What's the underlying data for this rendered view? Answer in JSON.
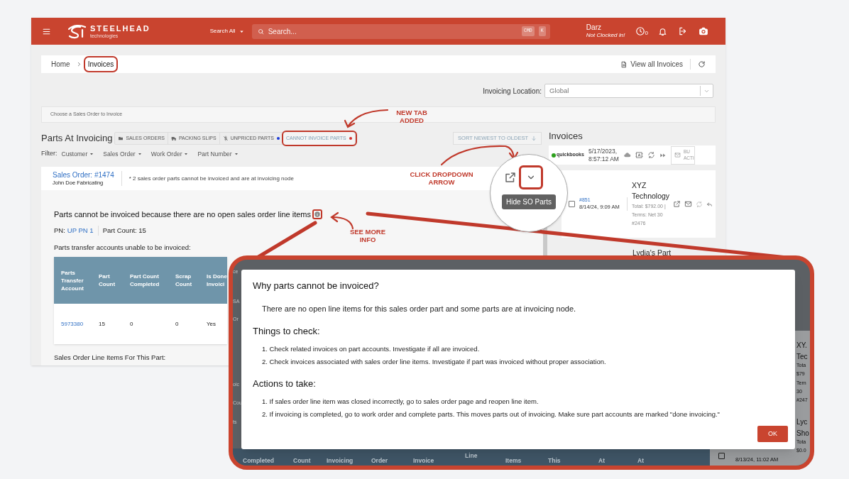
{
  "header": {
    "logo": {
      "wordmark": "STEELHEAD",
      "tagline": "technologies"
    },
    "search_scope": "Search All",
    "search": {
      "placeholder": "Search...",
      "shortcut": [
        "CMD",
        "K"
      ]
    },
    "user": {
      "name": "Darz",
      "status": "Not Clocked In!"
    },
    "clock_count": "0"
  },
  "breadcrumb": [
    {
      "label": "Home",
      "selected": false,
      "highlighted": false
    },
    {
      "label": "Invoices",
      "selected": true,
      "highlighted": true
    }
  ],
  "view_all": "View all Invoices",
  "location": {
    "label": "Invoicing Location:",
    "value": "Global"
  },
  "choose_hint": "Choose a Sales Order to Invoice",
  "parts_title": "Parts At Invoicing",
  "tabs": [
    {
      "label": "SALES ORDERS",
      "selected": false,
      "highlighted": false
    },
    {
      "label": "PACKING SLIPS",
      "selected": false,
      "highlighted": false
    },
    {
      "label": "UNPRICED PARTS",
      "selected": false,
      "highlighted": false,
      "color": "#1a3ad8"
    },
    {
      "label": "CANNOT INVOICE PARTS",
      "selected": true,
      "highlighted": true,
      "color": "#d32f2f"
    }
  ],
  "sort_button": "SORT NEWEST TO OLDEST",
  "filter_label": "Filter:",
  "filters": [
    "Customer",
    "Sales Order",
    "Work Order",
    "Part Number"
  ],
  "sales_order": {
    "link": "Sales Order: #1474",
    "customer": "John Doe Fabricating",
    "note": "* 2 sales order parts cannot be invoiced and are at invoicing node"
  },
  "tooltip": "Hide SO Parts",
  "reason": "Parts cannot be invoiced because there are no open sales order line items",
  "pn_label": "PN:",
  "pn": "UP PN 1",
  "part_count": "Part Count: 15",
  "accounts_title": "Parts transfer accounts unable to be invoiced:",
  "accounts_table": {
    "columns": [
      "Parts Transfer Account",
      "Part Count",
      "Part Count Completed",
      "Scrap Count",
      "Is Done Invoici"
    ],
    "rows": [
      [
        "5973380",
        "15",
        "0",
        "0",
        "Yes"
      ]
    ]
  },
  "line_items_title": "Sales Order Line Items For This Part:",
  "invoices_panel": {
    "title": "Invoices",
    "provider": "quickbooks",
    "sync_time": [
      "5/17/2023,",
      "8:57:12 AM"
    ],
    "bulk_button": [
      "BU",
      "ACTI"
    ],
    "invoices": [
      {
        "number": "#851",
        "date": "8/14/24, 9:09 AM",
        "customer": "XYZ Technology",
        "summary": "Total: $792.00 | Terms: Net 30",
        "ref": "#2476",
        "checked": false
      }
    ],
    "next_customer": "Lydia's Part"
  },
  "annotations": [
    "NEW TAB ADDED",
    "CLICK DROPDOWN ARROW",
    "SEE MORE INFO"
  ],
  "inset": {
    "left_fragments": [
      "ce",
      "SA",
      "Or",
      "oic",
      "Cou",
      "ts"
    ],
    "bottom_headers": [
      "Completed",
      "Count",
      "Invoicing",
      "Order",
      "Invoice",
      "Line",
      "Items",
      "This",
      "At",
      "At"
    ],
    "right_fragments": [
      "XY.",
      "Tec",
      "Tota",
      "$79",
      "Tern",
      "30",
      "#247",
      "Lyc",
      "Sho",
      "Tota",
      "$0.0"
    ],
    "bottom_row": {
      "date": "8/13/24, 11:02 AM",
      "checked": false
    }
  },
  "dialog": {
    "title": "Why parts cannot be invoiced?",
    "message": "There are no open line items for this sales order part and some parts are at invoicing node.",
    "sections": [
      {
        "heading": "Things to check:",
        "items": [
          "1. Check related invoices on part accounts. Investigate if all are invoiced.",
          "2. Check invoices associated with sales order line items. Investigate if part was invoiced without proper association."
        ]
      },
      {
        "heading": "Actions to take:",
        "items": [
          "1. If sales order line item was closed incorrectly, go to sales order page and reopen line item.",
          "2. If invoicing is completed, go to work order and complete parts. This moves parts out of invoicing. Make sure part accounts are marked \"done invoicing.\""
        ]
      }
    ],
    "ok": "OK"
  }
}
